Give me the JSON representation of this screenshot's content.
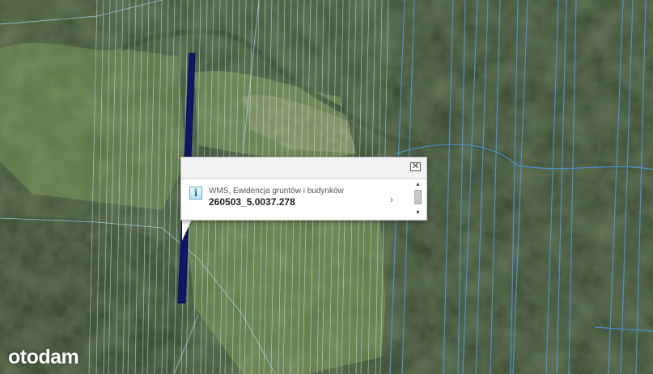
{
  "popup": {
    "layer_name": "WMS, Ewidencja gruntów i budynków",
    "parcel_id": "260503_5.0037.278",
    "close_icon": "close-icon",
    "info_icon": "info-icon",
    "info_glyph": "i",
    "chevron_icon": "chevron-right-icon",
    "chevron_glyph": "›",
    "close_glyph": "✕",
    "scroll_up_glyph": "▲",
    "scroll_down_glyph": "▼"
  },
  "watermark": {
    "text": "otodam"
  },
  "colors": {
    "parcel_lines": "#9fd4ee",
    "parcel_lines_strong": "#4a8fd6",
    "highlighted_parcel": "#12156b",
    "forest_dark": "#2c3a24",
    "meadow": "#5f7a3e"
  }
}
